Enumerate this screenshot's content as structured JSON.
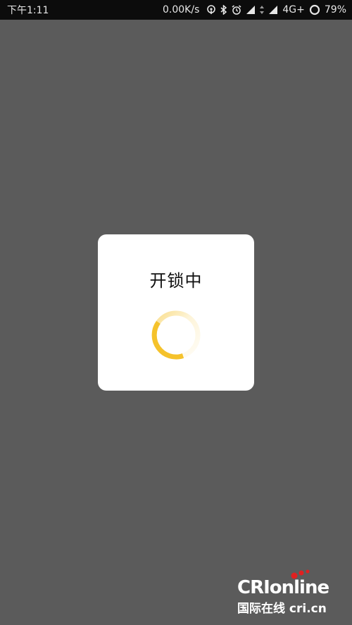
{
  "status_bar": {
    "time": "下午1:11",
    "net_speed": "0.00K/s",
    "network": "4G+",
    "battery": "79%",
    "icons": [
      "hotspot-icon",
      "bluetooth-icon",
      "alarm-icon",
      "signal-icon",
      "data-arrows-icon",
      "signal-icon",
      "battery-ring-icon"
    ]
  },
  "dialog": {
    "title": "开锁中",
    "spinner_color": "#f5c22b"
  },
  "watermark": {
    "logo": "CRIonline",
    "subtitle": "国际在线 cri.cn"
  },
  "colors": {
    "overlay": "#5b5b5b",
    "status_bar": "#0c0c0c",
    "dialog_bg": "#ffffff",
    "accent": "#f5c22b"
  }
}
